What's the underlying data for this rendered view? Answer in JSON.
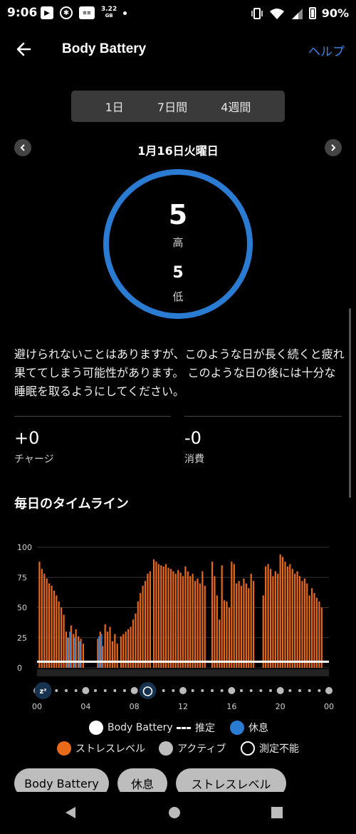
{
  "status_bar": {
    "time": "9:06",
    "battery_pct": "90%",
    "data_size_top": "3.22",
    "data_size_bottom": "GB",
    "icons": [
      "notification-icon",
      "accessibility-icon",
      "carrier-icon",
      "vibrate-icon",
      "wifi-icon",
      "signal-icon",
      "battery-icon"
    ]
  },
  "header": {
    "title": "Body Battery",
    "help": "ヘルプ"
  },
  "tabs": [
    "1日",
    "7日間",
    "4週間"
  ],
  "date": "1月16日火曜日",
  "summary": {
    "high_value": "5",
    "high_label": "高",
    "low_value": "5",
    "low_label": "低"
  },
  "message": "避けられないことはありますが、このような日が長く続くと疲れ果ててしまう可能性があります。 このような日の後には十分な睡眠を取るようにしてください。",
  "stats": [
    {
      "value": "+0",
      "label": "チャージ"
    },
    {
      "value": "-0",
      "label": "消費"
    }
  ],
  "timeline_title": "毎日のタイムライン",
  "chart_data": {
    "type": "bar",
    "y_ticks": [
      "100",
      "75",
      "50",
      "25",
      "0"
    ],
    "ylim": [
      0,
      100
    ],
    "x_ticks": [
      "00",
      "04",
      "08",
      "12",
      "16",
      "20",
      "00"
    ],
    "xlim_hours": [
      0,
      24
    ],
    "series": [
      {
        "name": "ストレスレベル",
        "color": "#e8691a",
        "points": [
          [
            0.2,
            88
          ],
          [
            0.4,
            82
          ],
          [
            0.6,
            78
          ],
          [
            0.8,
            74
          ],
          [
            1.0,
            70
          ],
          [
            1.2,
            68
          ],
          [
            1.4,
            64
          ],
          [
            1.6,
            60
          ],
          [
            1.8,
            55
          ],
          [
            2.0,
            50
          ],
          [
            2.2,
            44
          ],
          [
            2.4,
            30
          ],
          [
            2.6,
            25
          ],
          [
            2.8,
            35
          ],
          [
            3.0,
            28
          ],
          [
            3.2,
            32
          ],
          [
            3.4,
            26
          ],
          [
            3.6,
            24
          ],
          [
            3.8,
            20
          ],
          [
            5.0,
            24
          ],
          [
            5.2,
            30
          ],
          [
            5.4,
            18
          ],
          [
            5.6,
            36
          ],
          [
            5.8,
            30
          ],
          [
            6.0,
            34
          ],
          [
            6.2,
            22
          ],
          [
            6.4,
            28
          ],
          [
            6.6,
            20
          ],
          [
            6.9,
            26
          ],
          [
            7.1,
            28
          ],
          [
            7.3,
            30
          ],
          [
            7.5,
            32
          ],
          [
            7.7,
            34
          ],
          [
            7.9,
            40
          ],
          [
            8.1,
            45
          ],
          [
            8.3,
            55
          ],
          [
            8.5,
            62
          ],
          [
            8.7,
            68
          ],
          [
            8.9,
            72
          ],
          [
            9.1,
            78
          ],
          [
            9.3,
            80
          ],
          [
            9.6,
            90
          ],
          [
            9.8,
            88
          ],
          [
            10.0,
            86
          ],
          [
            10.2,
            85
          ],
          [
            10.4,
            84
          ],
          [
            10.6,
            86
          ],
          [
            10.8,
            83
          ],
          [
            11.0,
            82
          ],
          [
            11.2,
            80
          ],
          [
            11.4,
            78
          ],
          [
            11.6,
            81
          ],
          [
            11.8,
            79
          ],
          [
            12.0,
            76
          ],
          [
            12.2,
            84
          ],
          [
            12.4,
            80
          ],
          [
            12.6,
            76
          ],
          [
            12.8,
            78
          ],
          [
            13.0,
            72
          ],
          [
            13.2,
            74
          ],
          [
            13.4,
            70
          ],
          [
            13.6,
            80
          ],
          [
            13.8,
            68
          ],
          [
            14.4,
            88
          ],
          [
            14.6,
            76
          ],
          [
            14.8,
            60
          ],
          [
            15.0,
            40
          ],
          [
            15.2,
            85
          ],
          [
            15.4,
            56
          ],
          [
            15.6,
            55
          ],
          [
            15.8,
            50
          ],
          [
            16.0,
            88
          ],
          [
            16.2,
            86
          ],
          [
            16.4,
            70
          ],
          [
            16.6,
            72
          ],
          [
            16.8,
            68
          ],
          [
            17.0,
            74
          ],
          [
            17.2,
            70
          ],
          [
            17.4,
            66
          ],
          [
            17.6,
            78
          ],
          [
            17.8,
            72
          ],
          [
            18.6,
            60
          ],
          [
            18.8,
            84
          ],
          [
            19.0,
            86
          ],
          [
            19.2,
            82
          ],
          [
            19.4,
            76
          ],
          [
            19.6,
            80
          ],
          [
            19.8,
            78
          ],
          [
            20.0,
            94
          ],
          [
            20.2,
            92
          ],
          [
            20.4,
            88
          ],
          [
            20.6,
            84
          ],
          [
            20.8,
            86
          ],
          [
            21.0,
            82
          ],
          [
            21.2,
            78
          ],
          [
            21.4,
            80
          ],
          [
            21.6,
            76
          ],
          [
            21.8,
            72
          ],
          [
            22.0,
            74
          ],
          [
            22.2,
            70
          ],
          [
            22.4,
            60
          ],
          [
            22.6,
            66
          ],
          [
            22.8,
            62
          ],
          [
            23.0,
            58
          ],
          [
            23.2,
            55
          ],
          [
            23.4,
            50
          ]
        ]
      },
      {
        "name": "休息",
        "color": "#2a7bd2",
        "points": [
          [
            2.5,
            25
          ],
          [
            2.7,
            30
          ],
          [
            3.1,
            25
          ],
          [
            3.5,
            22
          ],
          [
            5.1,
            26
          ],
          [
            5.3,
            28
          ]
        ]
      },
      {
        "name": "Body Battery",
        "color": "#ffffff",
        "points": [
          [
            0,
            5
          ],
          [
            24,
            5
          ]
        ]
      }
    ]
  },
  "axis_icons": [
    "sleep-icon",
    "alarm-icon"
  ],
  "legend": [
    {
      "label": "Body Battery",
      "color": "#ffffff",
      "icon": "dot"
    },
    {
      "label": "推定",
      "color": "#ffffff",
      "icon": "dash"
    },
    {
      "label": "休息",
      "color": "#2a7bd2",
      "icon": "dot"
    },
    {
      "label": "ストレスレベル",
      "color": "#e8691a",
      "icon": "dot"
    },
    {
      "label": "アクティブ",
      "color": "#bdbdbd",
      "icon": "dot"
    },
    {
      "label": "測定不能",
      "color": "#000000",
      "icon": "ring"
    }
  ],
  "chips": [
    "Body Battery",
    "休息",
    "ストレスレベル"
  ]
}
